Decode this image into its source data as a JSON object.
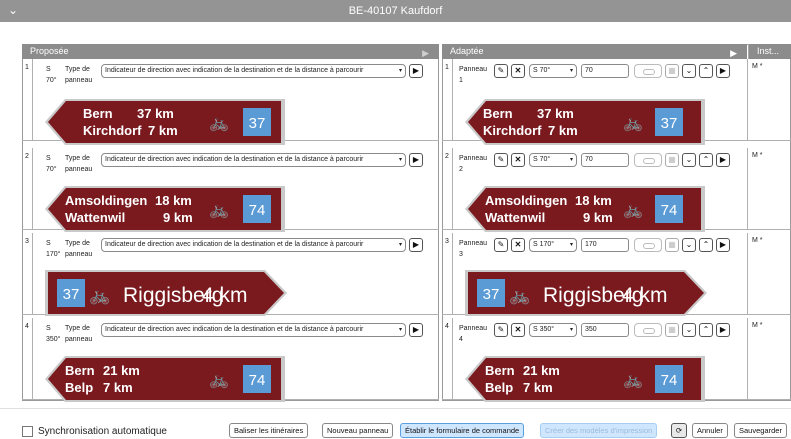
{
  "window": {
    "title": "BE-40107 Kaufdorf"
  },
  "colors": {
    "sign_red": "#7a1a1f",
    "route_blue": "#5b9bd5",
    "header_gray": "#8c8c8c"
  },
  "left": {
    "header": "Proposée",
    "rows": [
      {
        "num": "1",
        "dir": "S",
        "deg": "70°",
        "type_label": "Type de",
        "panneau": "panneau",
        "select": "Indicateur de direction avec indication de la destination et de la distance à parcourir"
      },
      {
        "num": "2",
        "dir": "S",
        "deg": "70°",
        "type_label": "Type de",
        "panneau": "panneau",
        "select": "Indicateur de direction avec indication de la destination et de la distance à parcourir"
      },
      {
        "num": "3",
        "dir": "S",
        "deg": "170°",
        "type_label": "Type de",
        "panneau": "panneau",
        "select": "Indicateur de direction avec indication de la destination et de la distance à parcourir"
      },
      {
        "num": "4",
        "dir": "S",
        "deg": "350°",
        "type_label": "Type de",
        "panneau": "panneau",
        "select": "Indicateur de direction avec indication de la destination et de la distance à parcourir"
      }
    ]
  },
  "right": {
    "header": "Adaptée",
    "inst_header": "Inst...",
    "rows": [
      {
        "num": "1",
        "label": "Panneau",
        "sub": "1",
        "dir_select": "S 70°",
        "value": "70",
        "inst": "M *"
      },
      {
        "num": "2",
        "label": "Panneau",
        "sub": "2",
        "dir_select": "S 70°",
        "value": "70",
        "inst": "M *"
      },
      {
        "num": "3",
        "label": "Panneau",
        "sub": "3",
        "dir_select": "S 170°",
        "value": "170",
        "inst": "M *"
      },
      {
        "num": "4",
        "label": "Panneau",
        "sub": "4",
        "dir_select": "S 350°",
        "value": "350",
        "inst": "M *"
      }
    ]
  },
  "signs": {
    "s1": {
      "dest1": "Bern",
      "km1": "37 km",
      "dest2": "Kirchdorf",
      "km2": "7 km",
      "route": "37"
    },
    "s2": {
      "dest1": "Amsoldingen",
      "km1": "18 km",
      "dest2": "Wattenwil",
      "km2": "9 km",
      "route": "74"
    },
    "s3": {
      "route": "37",
      "dest": "Riggisberg",
      "km": "4 km"
    },
    "s4": {
      "dest1": "Bern",
      "km1": "21 km",
      "dest2": "Belp",
      "km2": "7 km",
      "route": "74"
    }
  },
  "footer": {
    "sync_label": "Synchronisation automatique",
    "btn_baliser": "Baliser les itinéraires",
    "btn_nouveau": "Nouveau panneau",
    "btn_etablir": "Établir le formulaire de commande",
    "btn_creer": "Créer des modèles d'impression",
    "btn_annuler": "Annuler",
    "btn_sauvegarder": "Sauvegarder"
  }
}
